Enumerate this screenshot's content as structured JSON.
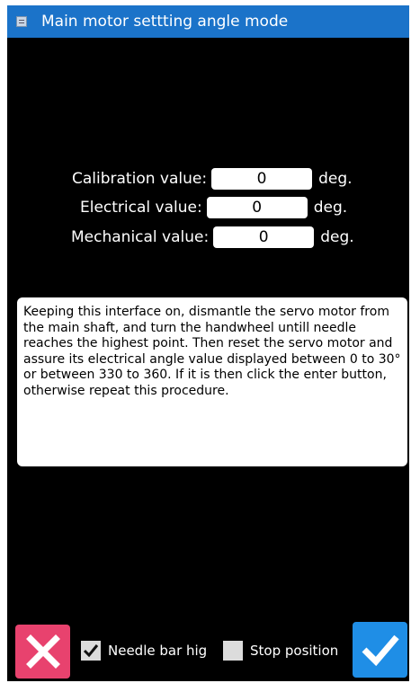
{
  "window": {
    "title": "Main motor settting angle mode",
    "icon": "window-menu-icon"
  },
  "fields": [
    {
      "label": "Calibration value:",
      "value": "0",
      "unit": "deg."
    },
    {
      "label": "Electrical value:",
      "value": "0",
      "unit": "deg."
    },
    {
      "label": "Mechanical value:",
      "value": "0",
      "unit": "deg."
    }
  ],
  "instructions": "Keeping this interface on, dismantle the servo motor from the main shaft, and turn the handwheel untill needle reaches the highest point. Then reset the servo motor and assure its electrical angle value displayed between 0 to 30° or between 330 to 360. If it is then click the enter button, otherwise repeat this procedure.",
  "footer": {
    "cancel_icon": "close-icon",
    "confirm_icon": "checkmark-icon",
    "options": [
      {
        "label": "Needle bar hig",
        "checked": true
      },
      {
        "label": "Stop position",
        "checked": false
      }
    ]
  },
  "colors": {
    "titlebar": "#1b73c9",
    "cancel": "#e8426e",
    "confirm": "#1f8ee6",
    "background": "#000000"
  }
}
